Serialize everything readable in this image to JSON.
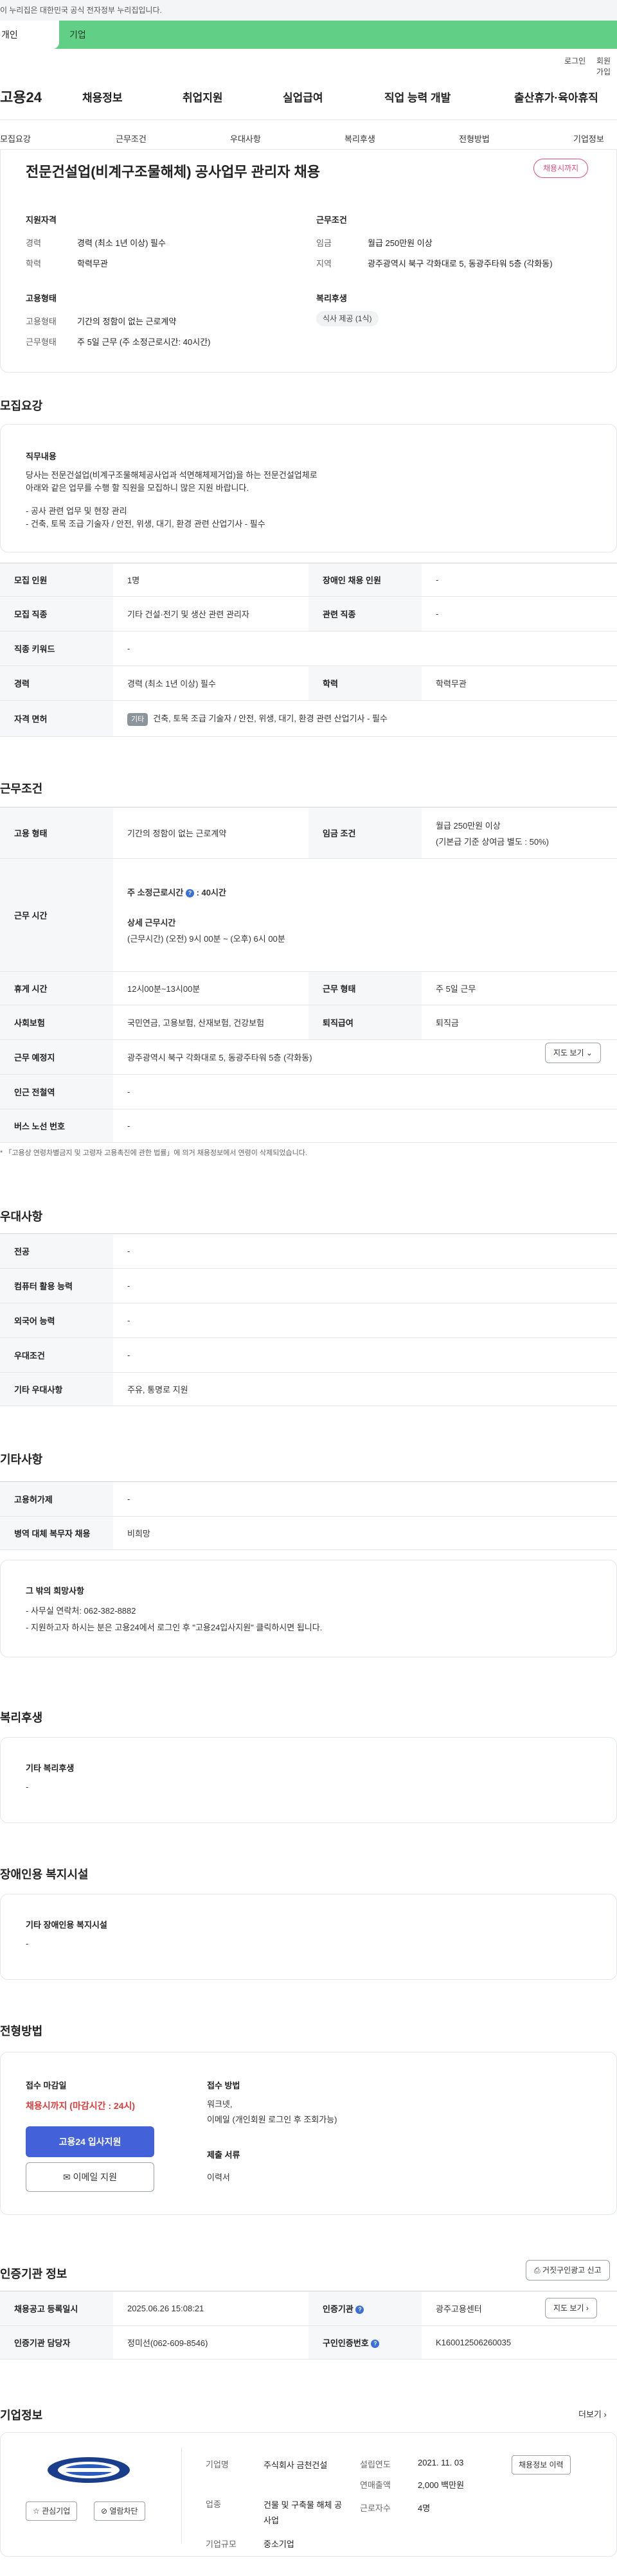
{
  "gov_notice": "이 누리집은 대한민국 공식 전자정부 누리집입니다.",
  "top_tabs": {
    "person": "개인",
    "company": "기업"
  },
  "util": {
    "login": "로그인",
    "signup": "회원가입"
  },
  "logo": "고용24",
  "gnb": [
    "채용정보",
    "취업지원",
    "실업급여",
    "직업 능력 개발",
    "출산휴가·육아휴직"
  ],
  "subnav": [
    "모집요강",
    "근무조건",
    "우대사항",
    "복리후생",
    "전형방법",
    "기업정보"
  ],
  "job": {
    "title": "전문건설업(비계구조물해체) 공사업무 관리자 채용",
    "status_badge": "채용시까지",
    "qual_heading": "지원자격",
    "career_label": "경력",
    "career_value": "경력 (최소 1년 이상) 필수",
    "edu_label": "학력",
    "edu_value": "학력무관",
    "cond_heading": "근무조건",
    "wage_label": "임금",
    "wage_value": "월급 250만원 이상",
    "area_label": "지역",
    "area_value": "광주광역시 북구 각화대로 5, 동광주타워 5층 (각화동)",
    "emp_heading": "고용형태",
    "emp_type_label": "고용형태",
    "emp_type_value": "기간의 정함이 없는 근로계약",
    "work_form_label": "근무형태",
    "work_form_value": "주 5일 근무 (주 소정근로시간: 40시간)",
    "welfare_heading": "복리후생",
    "welfare_chip": "식사 제공 (1식)"
  },
  "recruit": {
    "section_title": "모집요강",
    "duty_heading": "직무내용",
    "duty_lines": [
      "당사는 전문건설업(비계구조물해체공사업과 석면해체제거업)을 하는 전문건설업체로",
      "아래와 같은 업무를 수행 할 직원을 모집하니 많은 지원 바랍니다.",
      "",
      "- 공사 관련 업무 및 현장 관리",
      "- 건축, 토목 조급 기술자  /  안전, 위생, 대기, 환경 관련 산업기사 - 필수"
    ],
    "rows": [
      {
        "k1": "모집 인원",
        "v1": "1명",
        "k2": "장애인 채용 인원",
        "v2": "-"
      },
      {
        "k1": "모집 직종",
        "v1": "기타 건설·전기 및 생산 관련 관리자",
        "k2": "관련 직종",
        "v2": "-"
      },
      {
        "k1": "직종 키워드",
        "v1": "-"
      },
      {
        "k1": "경력",
        "v1": "경력 (최소 1년 이상) 필수",
        "k2": "학력",
        "v2": "학력무관"
      },
      {
        "k1": "자격 면허",
        "grade": "기타",
        "v1": "건축, 토목 조급 기술자 / 안전, 위생, 대기, 환경 관련 산업기사 - 필수"
      }
    ]
  },
  "conditions": {
    "section_title": "근무조건",
    "emp_label": "고용 형태",
    "emp_value": "기간의 정함이 없는 근로계약",
    "wage_label": "임금 조건",
    "wage_value": "월급 250만원 이상",
    "wage_note": "(기본급 기준 상여금 별도 : 50%)",
    "hours_label": "근무 시간",
    "hours_weekly": "주 소정근로시간",
    "hours_weekly_value": ": 40시간",
    "hours_detail_title": "상세 근무시간",
    "hours_detail": "(근무시간) (오전) 9시 00분 ~ (오후) 6시 00분",
    "break_label": "휴게 시간",
    "break_value": "12시00분~13시00분",
    "form_label": "근무 형태",
    "form_value": "주 5일 근무",
    "ins_label": "사회보험",
    "ins_value": "국민연금, 고용보험, 산재보험, 건강보험",
    "ret_label": "퇴직급여",
    "ret_value": "퇴직금",
    "loc_label": "근무 예정지",
    "loc_value": "광주광역시 북구 각화대로 5, 동광주타워 5층 (각화동)",
    "map_btn": "지도 보기",
    "subway_label": "인근 전철역",
    "subway_value": "-",
    "bus_label": "버스 노선 번호",
    "bus_value": "-",
    "footnote": "* 「고용상 연령차별금지 및 고령자 고용촉진에 관한 법률」에 의거 채용정보에서 연령이 삭제되었습니다."
  },
  "pref": {
    "section_title": "우대사항",
    "rows": [
      {
        "k": "전공",
        "v": "-"
      },
      {
        "k": "컴퓨터 활용 능력",
        "v": "-"
      },
      {
        "k": "외국어 능력",
        "v": "-"
      },
      {
        "k": "우대조건",
        "v": "-"
      },
      {
        "k": "기타 우대사항",
        "v": "주유, 통명로 지원"
      }
    ]
  },
  "etc": {
    "section_title": "기타사항",
    "rows": [
      {
        "k": "고용허가제",
        "v": "-"
      },
      {
        "k": "병역 대체 복무자 채용",
        "v": "비희망"
      }
    ],
    "other_heading": "그 밖의 희망사항",
    "other_lines": [
      "- 사무실 연락처: 062-382-8882",
      "- 지원하고자 하시는 분은 고용24에서 로그인 후 \"고용24입사지원\" 클릭하시면 됩니다."
    ]
  },
  "welfare": {
    "section_title": "복리후생",
    "heading": "기타 복리후생",
    "value": "-"
  },
  "disability": {
    "section_title": "장애인용 복지시설",
    "heading": "기타 장애인용 복지시설",
    "value": "-"
  },
  "selection": {
    "section_title": "전형방법",
    "deadline_label": "접수 마감일",
    "deadline_value": "채용시까지 (마감시간 : 24시)",
    "apply_btn": "고용24 입사지원",
    "email_btn": "이메일 지원",
    "method_label": "접수 방법",
    "method_value1": "워크넷,",
    "method_value2": "이메일 (개인회원 로그인 후 조회가능)",
    "docs_label": "제출 서류",
    "docs_value": "이력서"
  },
  "agency": {
    "section_title": "인증기관 정보",
    "report_btn": "거짓구인광고 신고",
    "reg_label": "채용공고 등록일시",
    "reg_value": "2025.06.26 15:08:21",
    "org_label": "인증기관",
    "org_value": "광주고용센터",
    "map_btn": "지도 보기",
    "mgr_label": "인증기관 담당자",
    "mgr_value": "정미선(062-609-8546)",
    "num_label": "구인인증번호",
    "num_value": "K160012506260035"
  },
  "company": {
    "section_title": "기업정보",
    "more": "더보기",
    "interest_btn": "관심기업",
    "block_btn": "열람차단",
    "name_label": "기업명",
    "name_value": "주식회사 금천건설",
    "industry_label": "업종",
    "industry_value": "건물 및 구축물 해체 공사업",
    "size_label": "기업규모",
    "size_value": "중소기업",
    "found_label": "설립연도",
    "found_value": "2021. 11. 03",
    "sales_label": "연매출액",
    "sales_value": "2,000 백만원",
    "emp_label": "근로자수",
    "emp_value": "4명",
    "info_btn": "채용정보 이력"
  },
  "colors": {
    "brand_green": "#62cf86",
    "accent_blue": "#4361d8",
    "deadline_red": "#e23b3b",
    "badge_pink": "#e8497e"
  }
}
